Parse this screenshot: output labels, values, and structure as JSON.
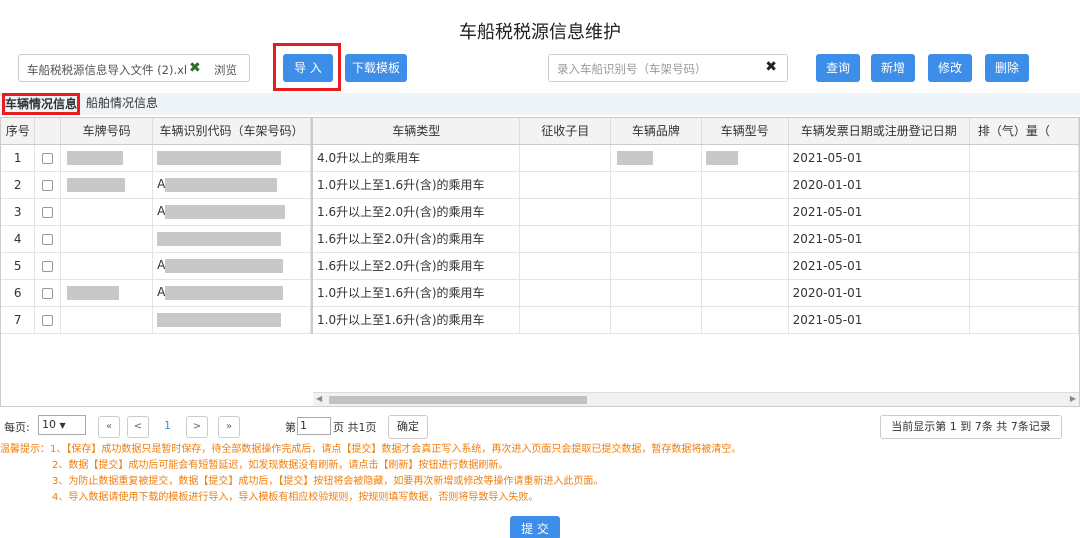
{
  "page": {
    "title": "车船税税源信息维护"
  },
  "toolbar": {
    "file_name": "车船税税源信息导入文件 (2).xl",
    "browse_label": "浏览",
    "import_label": "导 入",
    "template_label": "下载模板",
    "search_placeholder": "录入车船识别号（车架号码）",
    "query_label": "查询",
    "add_label": "新增",
    "edit_label": "修改",
    "delete_label": "删除"
  },
  "tabs": [
    {
      "label": "车辆情况信息",
      "active": true
    },
    {
      "label": "船舶情况信息",
      "active": false
    }
  ],
  "grid": {
    "headers": {
      "seq": "序号",
      "plate": "车牌号码",
      "vin": "车辆识别代码（车架号码）",
      "vehicle_type": "车辆类型",
      "tax_item": "征收子目",
      "brand": "车辆品牌",
      "model": "车辆型号",
      "date": "车辆发票日期或注册登记日期",
      "displacement": "排（气）量（"
    },
    "rows": [
      {
        "seq": "1",
        "vin_prefix": "",
        "vehicle_type": "4.0升以上的乘用车",
        "date": "2021-05-01"
      },
      {
        "seq": "2",
        "vin_prefix": "A",
        "vehicle_type": "1.0升以上至1.6升(含)的乘用车",
        "date": "2020-01-01"
      },
      {
        "seq": "3",
        "vin_prefix": "A",
        "vehicle_type": "1.6升以上至2.0升(含)的乘用车",
        "date": "2021-05-01"
      },
      {
        "seq": "4",
        "vin_prefix": "",
        "vehicle_type": "1.6升以上至2.0升(含)的乘用车",
        "date": "2021-05-01"
      },
      {
        "seq": "5",
        "vin_prefix": "A",
        "vehicle_type": "1.6升以上至2.0升(含)的乘用车",
        "date": "2021-05-01"
      },
      {
        "seq": "6",
        "vin_prefix": "A",
        "vehicle_type": "1.0升以上至1.6升(含)的乘用车",
        "date": "2020-01-01"
      },
      {
        "seq": "7",
        "vin_prefix": "",
        "vehicle_type": "1.0升以上至1.6升(含)的乘用车",
        "date": "2021-05-01"
      }
    ]
  },
  "pager": {
    "page_size_label": "每页:",
    "page_size": "10",
    "first": "«",
    "prev": "<",
    "current": "1",
    "next": ">",
    "last": "»",
    "goto_prefix": "第",
    "goto_value": "1",
    "goto_suffix": "页 共1页",
    "confirm_label": "确定",
    "record_info": "当前显示第  1 到  7条 共  7条记录"
  },
  "notes": [
    "温馨提示：1、【保存】成功数据只是暂时保存，待全部数据操作完成后，请点【提交】数据才会真正写入系统，再次进入页面只会提取已提交数据，暂存数据将被清空。",
    "2、数据【提交】成功后可能会有短暂延迟，如发现数据没有刷新，请点击【刷新】按钮进行数据刷新。",
    "3、为防止数据重复被提交，数据【提交】成功后，【提交】按钮将会被隐藏，如要再次新增或修改等操作请重新进入此页面。",
    "4、导入数据请使用下载的模板进行导入，导入模板有相应校验规则，按规则填写数据，否则将导致导入失败。"
  ],
  "submit_label": "提 交",
  "colors": {
    "accent": "#3c8ee8",
    "highlight": "#e81c1c",
    "notice": "#f07e0b"
  }
}
